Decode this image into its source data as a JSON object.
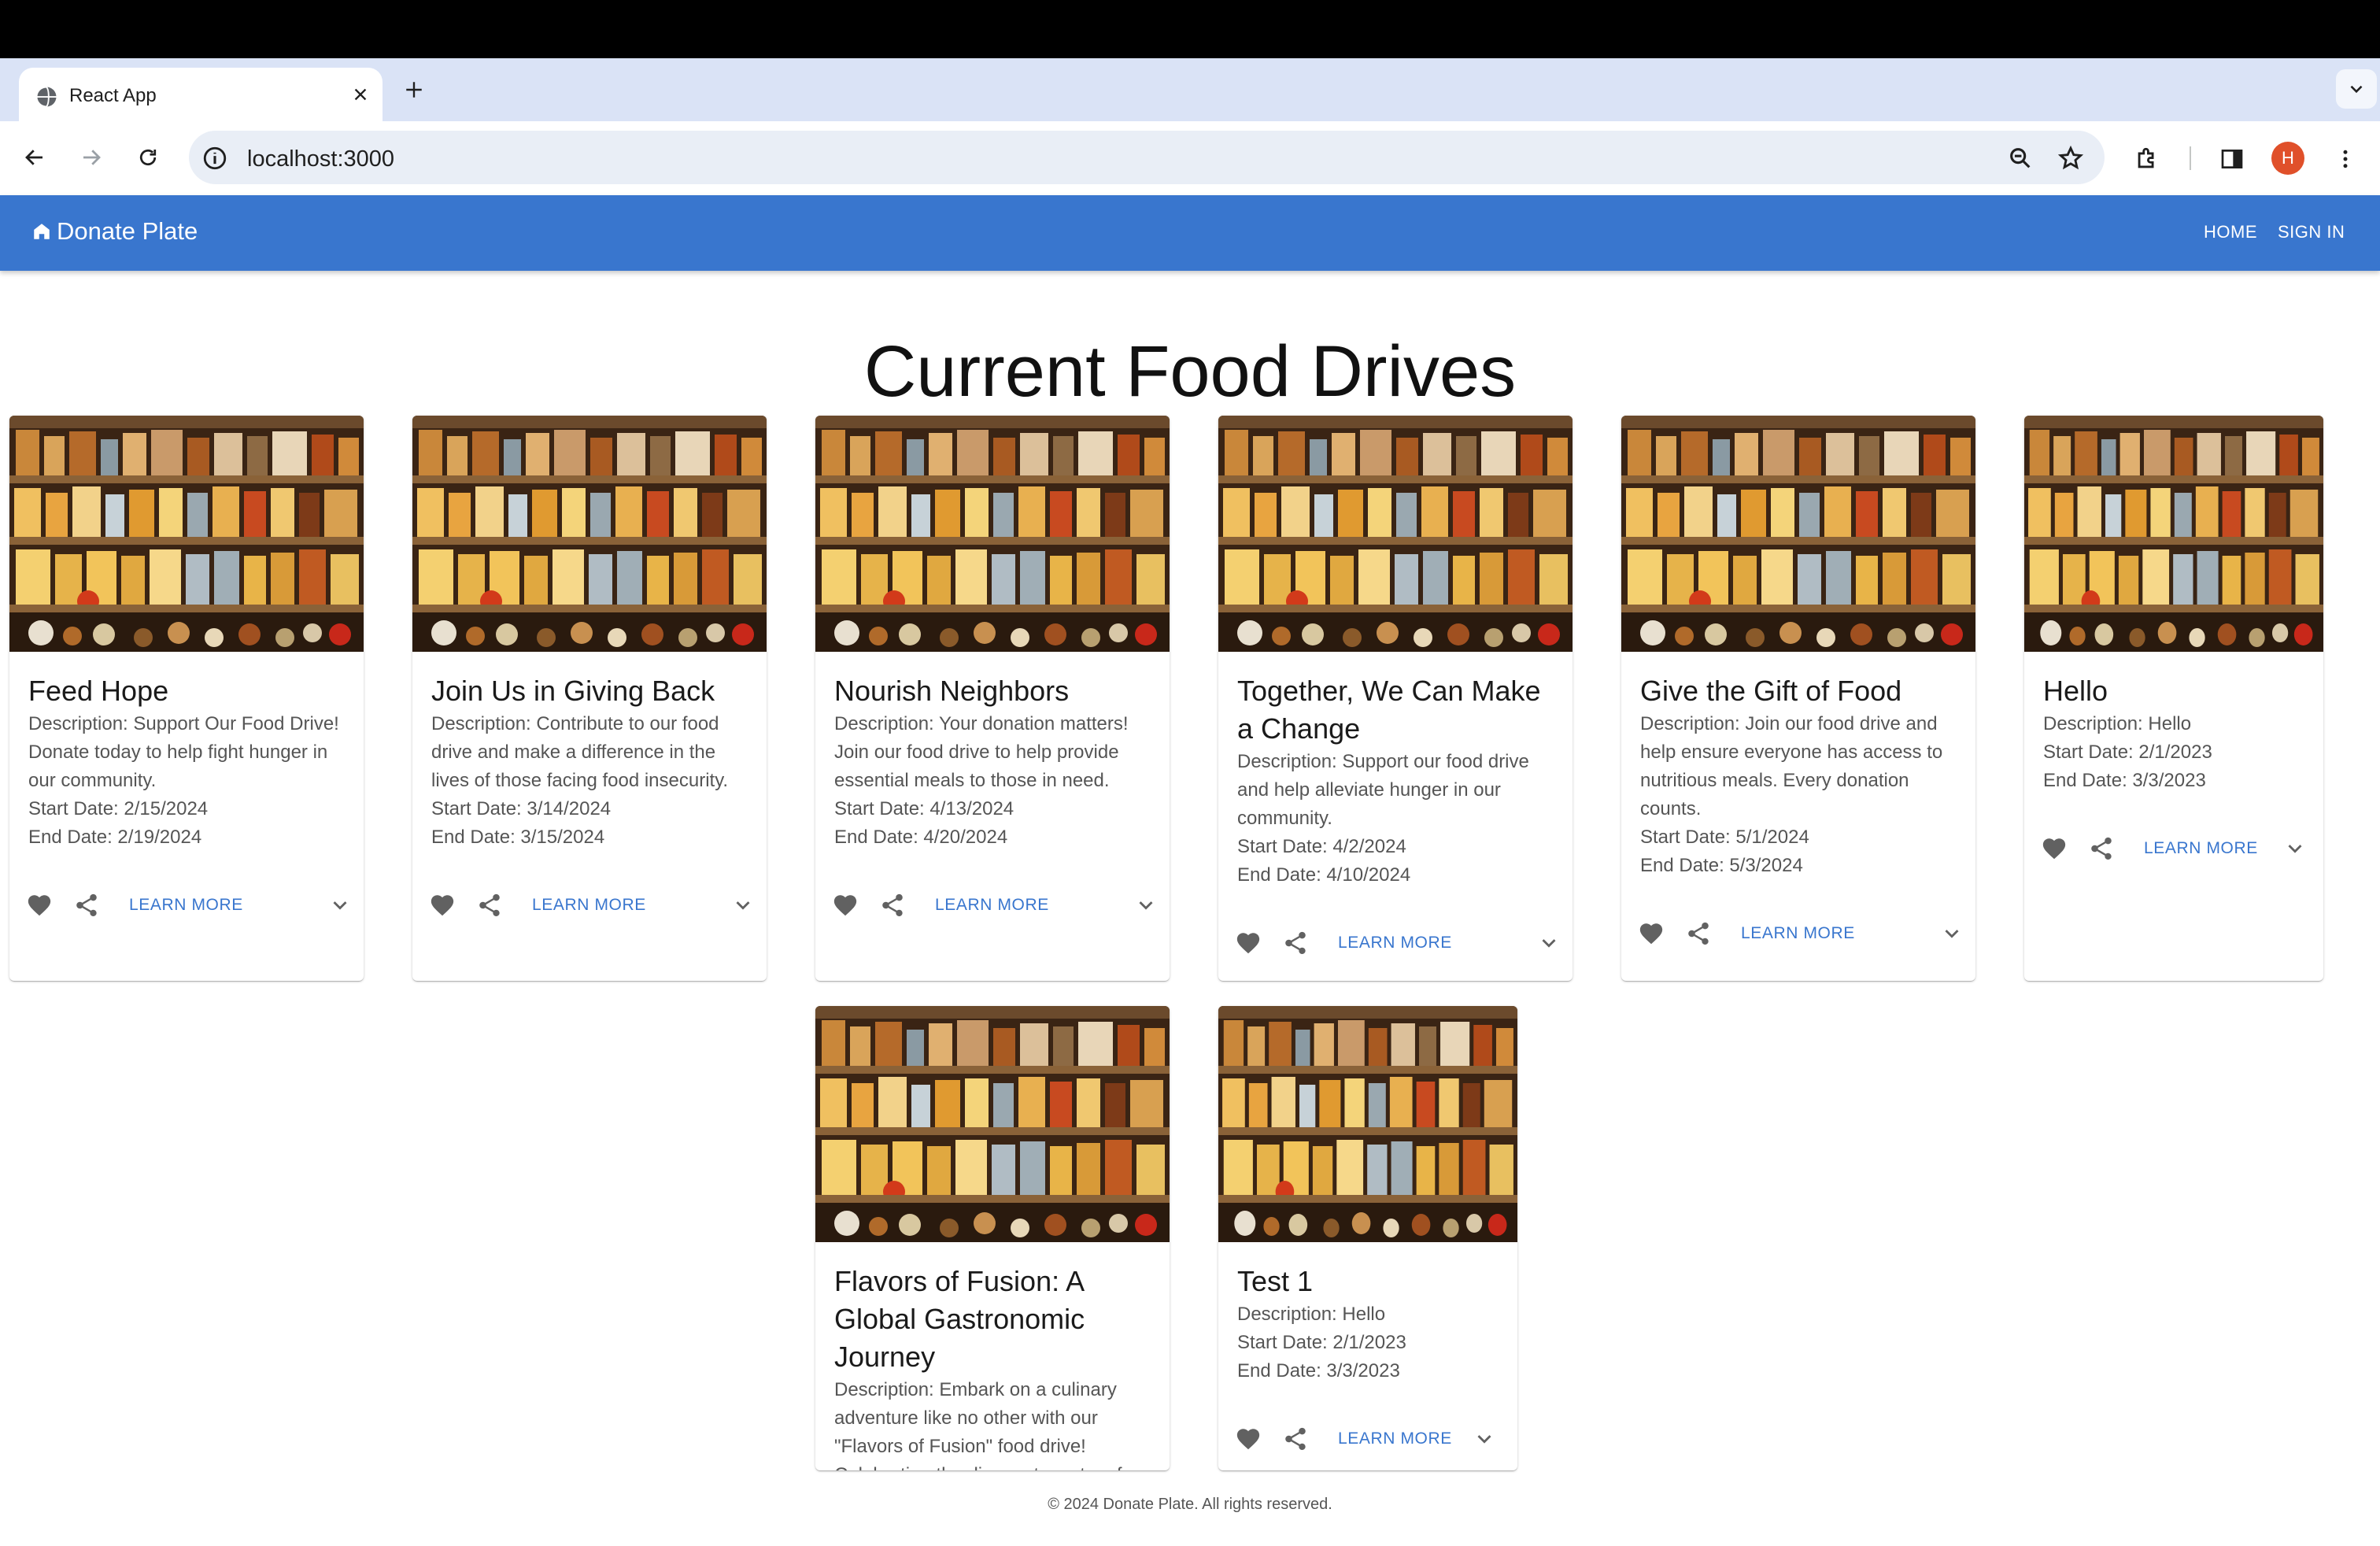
{
  "browser": {
    "tab_title": "React App",
    "url": "localhost:3000",
    "avatar_letter": "H"
  },
  "app": {
    "brand": "Donate Plate",
    "nav": {
      "home": "HOME",
      "sign_in": "SIGN IN"
    }
  },
  "page_title": "Current Food Drives",
  "cards": [
    {
      "title": "Feed Hope",
      "desc": "Description: Support Our Food Drive! Donate today to help fight hunger in our community.",
      "start": "Start Date: 2/15/2024",
      "end": "End Date: 2/19/2024",
      "learn": "LEARN MORE"
    },
    {
      "title": "Join Us in Giving Back",
      "desc": "Description: Contribute to our food drive and make a difference in the lives of those facing food insecurity.",
      "start": "Start Date: 3/14/2024",
      "end": "End Date: 3/15/2024",
      "learn": "LEARN MORE"
    },
    {
      "title": "Nourish Neighbors",
      "desc": "Description: Your donation matters! Join our food drive to help provide essential meals to those in need.",
      "start": "Start Date: 4/13/2024",
      "end": "End Date: 4/20/2024",
      "learn": "LEARN MORE"
    },
    {
      "title": "Together, We Can Make a Change",
      "desc": "Description: Support our food drive and help alleviate hunger in our community.",
      "start": "Start Date: 4/2/2024",
      "end": "End Date: 4/10/2024",
      "learn": "LEARN MORE"
    },
    {
      "title": "Give the Gift of Food",
      "desc": "Description: Join our food drive and help ensure everyone has access to nutritious meals. Every donation counts.",
      "start": "Start Date: 5/1/2024",
      "end": "End Date: 5/3/2024",
      "learn": "LEARN MORE"
    },
    {
      "title": "Hello",
      "desc": "Description: Hello",
      "start": "Start Date: 2/1/2023",
      "end": "End Date: 3/3/2023",
      "learn": "LEARN MORE"
    },
    {
      "title": "Flavors of Fusion: A Global Gastronomic Journey",
      "desc": "Description: Embark on a culinary adventure like no other with our \"Flavors of Fusion\" food drive! Celebrating the diverse tapestry of",
      "start": "",
      "end": "",
      "learn": ""
    },
    {
      "title": "Test 1",
      "desc": "Description: Hello",
      "start": "Start Date: 2/1/2023",
      "end": "End Date: 3/3/2023",
      "learn": "LEARN MORE"
    }
  ],
  "footer": "© 2024 Donate Plate. All rights reserved.",
  "colors": {
    "brand": "#3976ce",
    "tabstrip": "#dae3f6"
  }
}
